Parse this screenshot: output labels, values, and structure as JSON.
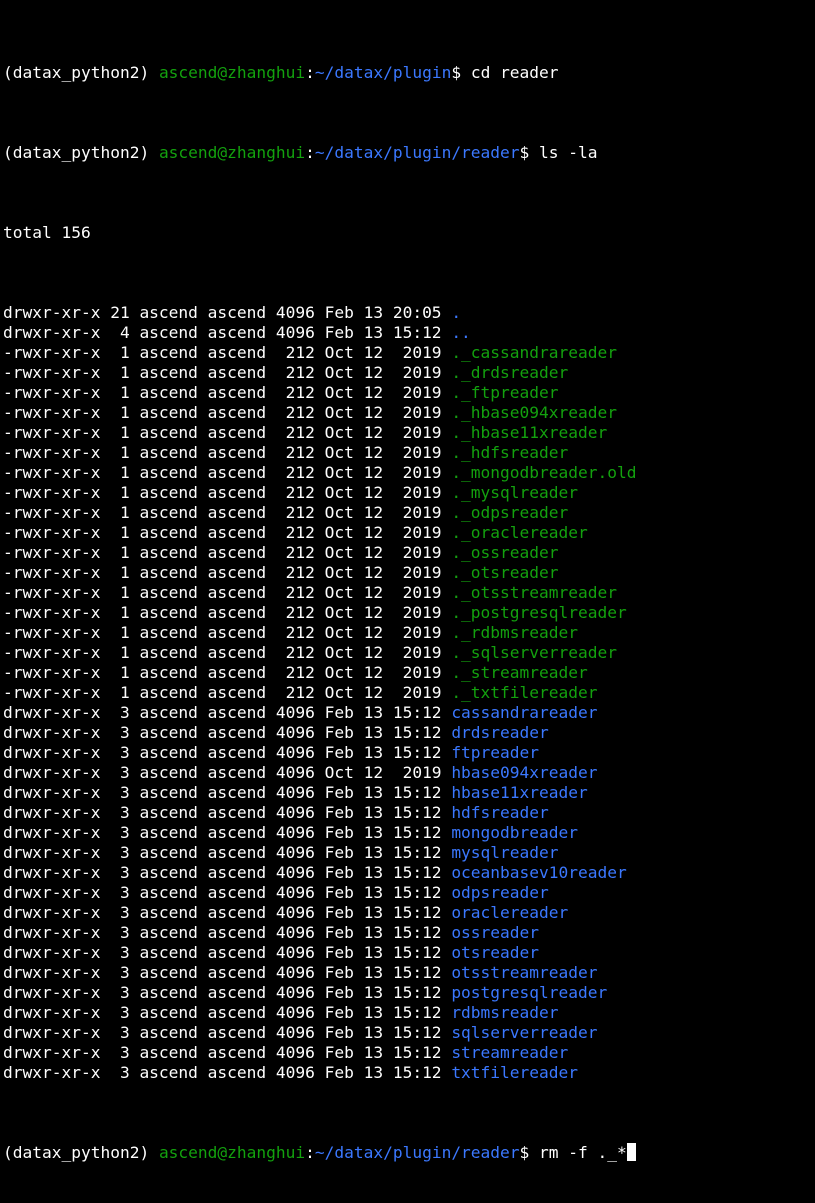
{
  "colors": {
    "background": "#000000",
    "text": "#ffffff",
    "user_host": "#13a10e",
    "path": "#3b78ff",
    "hidden_file": "#13a10e",
    "directory": "#3b78ff"
  },
  "prompts": [
    {
      "env": "(datax_python2) ",
      "userhost": "ascend@zhanghui",
      "sep": ":",
      "path": "~/datax/plugin",
      "sigil": "$ ",
      "command": "cd reader"
    },
    {
      "env": "(datax_python2) ",
      "userhost": "ascend@zhanghui",
      "sep": ":",
      "path": "~/datax/plugin/reader",
      "sigil": "$ ",
      "command": "ls -la"
    }
  ],
  "total_line": "total 156",
  "listing": [
    {
      "meta": "drwxr-xr-x 21 ascend ascend 4096 Feb 13 20:05 ",
      "name": ".",
      "kind": "dir"
    },
    {
      "meta": "drwxr-xr-x  4 ascend ascend 4096 Feb 13 15:12 ",
      "name": "..",
      "kind": "dir"
    },
    {
      "meta": "-rwxr-xr-x  1 ascend ascend  212 Oct 12  2019 ",
      "name": "._cassandrareader",
      "kind": "hidden"
    },
    {
      "meta": "-rwxr-xr-x  1 ascend ascend  212 Oct 12  2019 ",
      "name": "._drdsreader",
      "kind": "hidden"
    },
    {
      "meta": "-rwxr-xr-x  1 ascend ascend  212 Oct 12  2019 ",
      "name": "._ftpreader",
      "kind": "hidden"
    },
    {
      "meta": "-rwxr-xr-x  1 ascend ascend  212 Oct 12  2019 ",
      "name": "._hbase094xreader",
      "kind": "hidden"
    },
    {
      "meta": "-rwxr-xr-x  1 ascend ascend  212 Oct 12  2019 ",
      "name": "._hbase11xreader",
      "kind": "hidden"
    },
    {
      "meta": "-rwxr-xr-x  1 ascend ascend  212 Oct 12  2019 ",
      "name": "._hdfsreader",
      "kind": "hidden"
    },
    {
      "meta": "-rwxr-xr-x  1 ascend ascend  212 Oct 12  2019 ",
      "name": "._mongodbreader.old",
      "kind": "hidden"
    },
    {
      "meta": "-rwxr-xr-x  1 ascend ascend  212 Oct 12  2019 ",
      "name": "._mysqlreader",
      "kind": "hidden"
    },
    {
      "meta": "-rwxr-xr-x  1 ascend ascend  212 Oct 12  2019 ",
      "name": "._odpsreader",
      "kind": "hidden"
    },
    {
      "meta": "-rwxr-xr-x  1 ascend ascend  212 Oct 12  2019 ",
      "name": "._oraclereader",
      "kind": "hidden"
    },
    {
      "meta": "-rwxr-xr-x  1 ascend ascend  212 Oct 12  2019 ",
      "name": "._ossreader",
      "kind": "hidden"
    },
    {
      "meta": "-rwxr-xr-x  1 ascend ascend  212 Oct 12  2019 ",
      "name": "._otsreader",
      "kind": "hidden"
    },
    {
      "meta": "-rwxr-xr-x  1 ascend ascend  212 Oct 12  2019 ",
      "name": "._otsstreamreader",
      "kind": "hidden"
    },
    {
      "meta": "-rwxr-xr-x  1 ascend ascend  212 Oct 12  2019 ",
      "name": "._postgresqlreader",
      "kind": "hidden"
    },
    {
      "meta": "-rwxr-xr-x  1 ascend ascend  212 Oct 12  2019 ",
      "name": "._rdbmsreader",
      "kind": "hidden"
    },
    {
      "meta": "-rwxr-xr-x  1 ascend ascend  212 Oct 12  2019 ",
      "name": "._sqlserverreader",
      "kind": "hidden"
    },
    {
      "meta": "-rwxr-xr-x  1 ascend ascend  212 Oct 12  2019 ",
      "name": "._streamreader",
      "kind": "hidden"
    },
    {
      "meta": "-rwxr-xr-x  1 ascend ascend  212 Oct 12  2019 ",
      "name": "._txtfilereader",
      "kind": "hidden"
    },
    {
      "meta": "drwxr-xr-x  3 ascend ascend 4096 Feb 13 15:12 ",
      "name": "cassandrareader",
      "kind": "dir"
    },
    {
      "meta": "drwxr-xr-x  3 ascend ascend 4096 Feb 13 15:12 ",
      "name": "drdsreader",
      "kind": "dir"
    },
    {
      "meta": "drwxr-xr-x  3 ascend ascend 4096 Feb 13 15:12 ",
      "name": "ftpreader",
      "kind": "dir"
    },
    {
      "meta": "drwxr-xr-x  3 ascend ascend 4096 Oct 12  2019 ",
      "name": "hbase094xreader",
      "kind": "dir"
    },
    {
      "meta": "drwxr-xr-x  3 ascend ascend 4096 Feb 13 15:12 ",
      "name": "hbase11xreader",
      "kind": "dir"
    },
    {
      "meta": "drwxr-xr-x  3 ascend ascend 4096 Feb 13 15:12 ",
      "name": "hdfsreader",
      "kind": "dir"
    },
    {
      "meta": "drwxr-xr-x  3 ascend ascend 4096 Feb 13 15:12 ",
      "name": "mongodbreader",
      "kind": "dir"
    },
    {
      "meta": "drwxr-xr-x  3 ascend ascend 4096 Feb 13 15:12 ",
      "name": "mysqlreader",
      "kind": "dir"
    },
    {
      "meta": "drwxr-xr-x  3 ascend ascend 4096 Feb 13 15:12 ",
      "name": "oceanbasev10reader",
      "kind": "dir"
    },
    {
      "meta": "drwxr-xr-x  3 ascend ascend 4096 Feb 13 15:12 ",
      "name": "odpsreader",
      "kind": "dir"
    },
    {
      "meta": "drwxr-xr-x  3 ascend ascend 4096 Feb 13 15:12 ",
      "name": "oraclereader",
      "kind": "dir"
    },
    {
      "meta": "drwxr-xr-x  3 ascend ascend 4096 Feb 13 15:12 ",
      "name": "ossreader",
      "kind": "dir"
    },
    {
      "meta": "drwxr-xr-x  3 ascend ascend 4096 Feb 13 15:12 ",
      "name": "otsreader",
      "kind": "dir"
    },
    {
      "meta": "drwxr-xr-x  3 ascend ascend 4096 Feb 13 15:12 ",
      "name": "otsstreamreader",
      "kind": "dir"
    },
    {
      "meta": "drwxr-xr-x  3 ascend ascend 4096 Feb 13 15:12 ",
      "name": "postgresqlreader",
      "kind": "dir"
    },
    {
      "meta": "drwxr-xr-x  3 ascend ascend 4096 Feb 13 15:12 ",
      "name": "rdbmsreader",
      "kind": "dir"
    },
    {
      "meta": "drwxr-xr-x  3 ascend ascend 4096 Feb 13 15:12 ",
      "name": "sqlserverreader",
      "kind": "dir"
    },
    {
      "meta": "drwxr-xr-x  3 ascend ascend 4096 Feb 13 15:12 ",
      "name": "streamreader",
      "kind": "dir"
    },
    {
      "meta": "drwxr-xr-x  3 ascend ascend 4096 Feb 13 15:12 ",
      "name": "txtfilereader",
      "kind": "dir"
    }
  ],
  "final_prompt": {
    "env": "(datax_python2) ",
    "userhost": "ascend@zhanghui",
    "sep": ":",
    "path": "~/datax/plugin/reader",
    "sigil": "$ ",
    "command": "rm -f ._*"
  }
}
